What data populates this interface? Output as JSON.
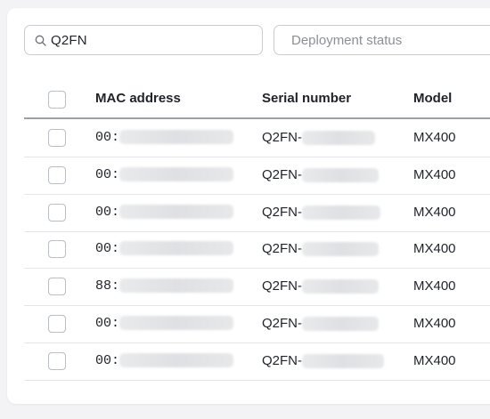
{
  "search": {
    "value": "Q2FN"
  },
  "filter": {
    "placeholder": "Deployment status"
  },
  "table": {
    "columns": [
      "MAC address",
      "Serial number",
      "Model"
    ],
    "rows": [
      {
        "mac": "00:",
        "serial": "Q2FN-",
        "model": "MX400"
      },
      {
        "mac": "00:",
        "serial": "Q2FN-",
        "model": "MX400"
      },
      {
        "mac": "00:",
        "serial": "Q2FN-",
        "model": "MX400"
      },
      {
        "mac": "00:",
        "serial": "Q2FN-",
        "model": "MX400"
      },
      {
        "mac": "88:",
        "serial": "Q2FN-",
        "model": "MX400"
      },
      {
        "mac": "00:",
        "serial": "Q2FN-",
        "model": "MX400"
      },
      {
        "mac": "00:",
        "serial": "Q2FN-",
        "model": "MX400"
      }
    ]
  }
}
